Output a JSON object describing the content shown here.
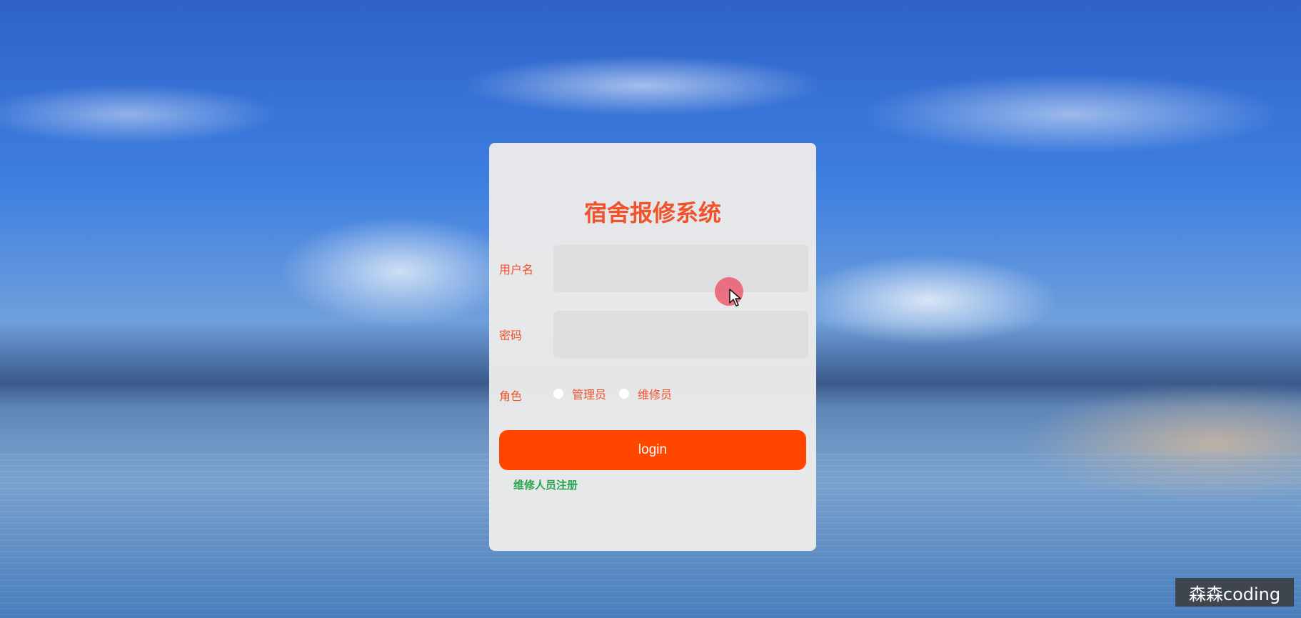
{
  "app": {
    "title": "宿舍报修系统"
  },
  "form": {
    "username_label": "用户名",
    "username_placeholder": "",
    "password_label": "密码",
    "password_placeholder": "",
    "role_label": "角色",
    "roles": [
      {
        "label": "管理员",
        "selected": false
      },
      {
        "label": "维修员",
        "selected": false
      }
    ],
    "login_label": "login",
    "register_link": "维修人员注册"
  },
  "overlay": {
    "watermark": "森森coding"
  },
  "colors": {
    "accent": "#ff4500",
    "title": "#f0522a",
    "link": "#2aa44f",
    "panel": "#eaeaea"
  }
}
